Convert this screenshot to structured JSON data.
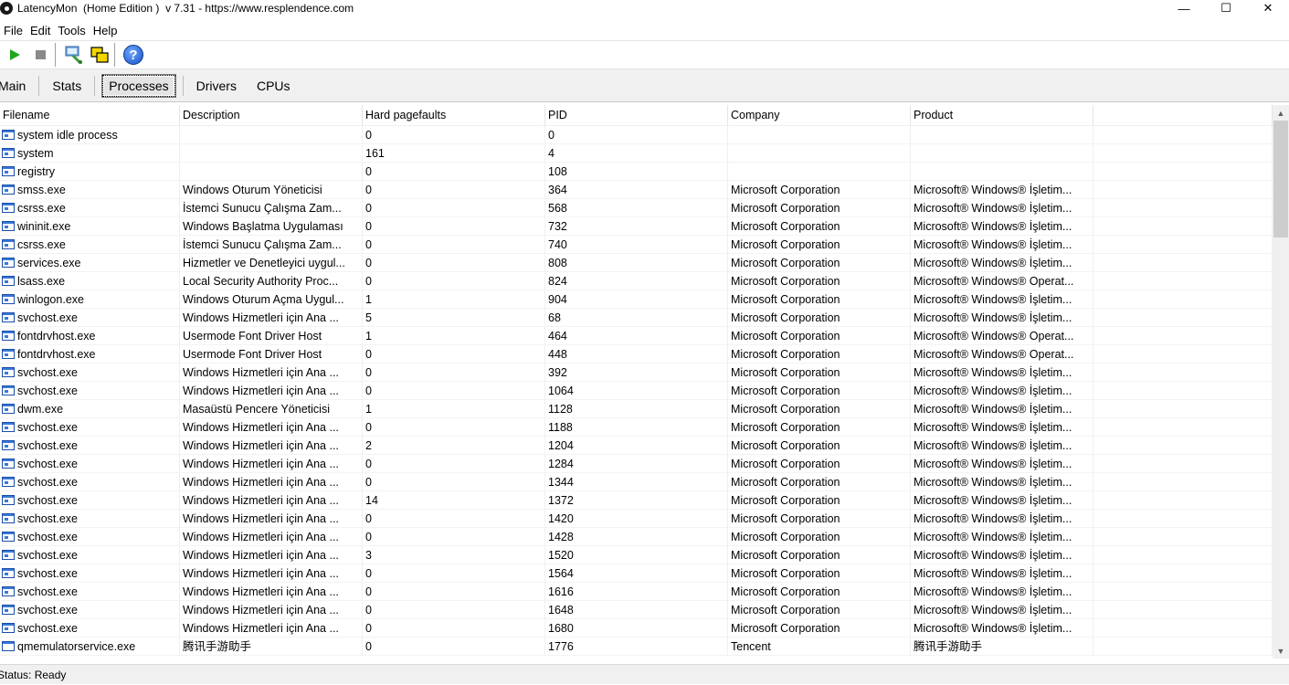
{
  "window": {
    "title": "LatencyMon  (Home Edition )  v 7.31 - https://www.resplendence.com",
    "minimize": "—",
    "maximize": "☐",
    "close": "✕"
  },
  "menu": [
    "File",
    "Edit",
    "Tools",
    "Help"
  ],
  "toolbar": {
    "icons": [
      "play-icon",
      "stop-icon",
      "monitor-icon",
      "windows-icon",
      "help-icon"
    ],
    "help_glyph": "?"
  },
  "tabs": [
    {
      "label": "Main",
      "active": false
    },
    {
      "label": "Stats",
      "active": false
    },
    {
      "label": "Processes",
      "active": true
    },
    {
      "label": "Drivers",
      "active": false
    },
    {
      "label": "CPUs",
      "active": false
    }
  ],
  "table": {
    "columns": [
      "Filename",
      "Description",
      "Hard pagefaults",
      "PID",
      "Company",
      "Product",
      ""
    ],
    "rows": [
      [
        "system idle process",
        "",
        "0",
        "0",
        "",
        ""
      ],
      [
        "system",
        "",
        "161",
        "4",
        "",
        ""
      ],
      [
        "registry",
        "",
        "0",
        "108",
        "",
        ""
      ],
      [
        "smss.exe",
        "Windows Oturum Yöneticisi",
        "0",
        "364",
        "Microsoft Corporation",
        "Microsoft® Windows® İşletim..."
      ],
      [
        "csrss.exe",
        "İstemci Sunucu Çalışma Zam...",
        "0",
        "568",
        "Microsoft Corporation",
        "Microsoft® Windows® İşletim..."
      ],
      [
        "wininit.exe",
        "Windows Başlatma Uygulaması",
        "0",
        "732",
        "Microsoft Corporation",
        "Microsoft® Windows® İşletim..."
      ],
      [
        "csrss.exe",
        "İstemci Sunucu Çalışma Zam...",
        "0",
        "740",
        "Microsoft Corporation",
        "Microsoft® Windows® İşletim..."
      ],
      [
        "services.exe",
        "Hizmetler ve Denetleyici uygul...",
        "0",
        "808",
        "Microsoft Corporation",
        "Microsoft® Windows® İşletim..."
      ],
      [
        "lsass.exe",
        "Local Security Authority Proc...",
        "0",
        "824",
        "Microsoft Corporation",
        "Microsoft® Windows® Operat..."
      ],
      [
        "winlogon.exe",
        "Windows Oturum Açma Uygul...",
        "1",
        "904",
        "Microsoft Corporation",
        "Microsoft® Windows® İşletim..."
      ],
      [
        "svchost.exe",
        "Windows Hizmetleri için Ana ...",
        "5",
        "68",
        "Microsoft Corporation",
        "Microsoft® Windows® İşletim..."
      ],
      [
        "fontdrvhost.exe",
        "Usermode Font Driver Host",
        "1",
        "464",
        "Microsoft Corporation",
        "Microsoft® Windows® Operat..."
      ],
      [
        "fontdrvhost.exe",
        "Usermode Font Driver Host",
        "0",
        "448",
        "Microsoft Corporation",
        "Microsoft® Windows® Operat..."
      ],
      [
        "svchost.exe",
        "Windows Hizmetleri için Ana ...",
        "0",
        "392",
        "Microsoft Corporation",
        "Microsoft® Windows® İşletim..."
      ],
      [
        "svchost.exe",
        "Windows Hizmetleri için Ana ...",
        "0",
        "1064",
        "Microsoft Corporation",
        "Microsoft® Windows® İşletim..."
      ],
      [
        "dwm.exe",
        "Masaüstü Pencere Yöneticisi",
        "1",
        "1128",
        "Microsoft Corporation",
        "Microsoft® Windows® İşletim..."
      ],
      [
        "svchost.exe",
        "Windows Hizmetleri için Ana ...",
        "0",
        "1188",
        "Microsoft Corporation",
        "Microsoft® Windows® İşletim..."
      ],
      [
        "svchost.exe",
        "Windows Hizmetleri için Ana ...",
        "2",
        "1204",
        "Microsoft Corporation",
        "Microsoft® Windows® İşletim..."
      ],
      [
        "svchost.exe",
        "Windows Hizmetleri için Ana ...",
        "0",
        "1284",
        "Microsoft Corporation",
        "Microsoft® Windows® İşletim..."
      ],
      [
        "svchost.exe",
        "Windows Hizmetleri için Ana ...",
        "0",
        "1344",
        "Microsoft Corporation",
        "Microsoft® Windows® İşletim..."
      ],
      [
        "svchost.exe",
        "Windows Hizmetleri için Ana ...",
        "14",
        "1372",
        "Microsoft Corporation",
        "Microsoft® Windows® İşletim..."
      ],
      [
        "svchost.exe",
        "Windows Hizmetleri için Ana ...",
        "0",
        "1420",
        "Microsoft Corporation",
        "Microsoft® Windows® İşletim..."
      ],
      [
        "svchost.exe",
        "Windows Hizmetleri için Ana ...",
        "0",
        "1428",
        "Microsoft Corporation",
        "Microsoft® Windows® İşletim..."
      ],
      [
        "svchost.exe",
        "Windows Hizmetleri için Ana ...",
        "3",
        "1520",
        "Microsoft Corporation",
        "Microsoft® Windows® İşletim..."
      ],
      [
        "svchost.exe",
        "Windows Hizmetleri için Ana ...",
        "0",
        "1564",
        "Microsoft Corporation",
        "Microsoft® Windows® İşletim..."
      ],
      [
        "svchost.exe",
        "Windows Hizmetleri için Ana ...",
        "0",
        "1616",
        "Microsoft Corporation",
        "Microsoft® Windows® İşletim..."
      ],
      [
        "svchost.exe",
        "Windows Hizmetleri için Ana ...",
        "0",
        "1648",
        "Microsoft Corporation",
        "Microsoft® Windows® İşletim..."
      ],
      [
        "svchost.exe",
        "Windows Hizmetleri için Ana ...",
        "0",
        "1680",
        "Microsoft Corporation",
        "Microsoft® Windows® İşletim..."
      ],
      [
        "qmemulatorservice.exe",
        "腾讯手游助手",
        "0",
        "1776",
        "Tencent",
        "腾讯手游助手"
      ]
    ]
  },
  "scrollbar": {
    "up": "▲",
    "down": "▼"
  },
  "status": "Status: Ready"
}
